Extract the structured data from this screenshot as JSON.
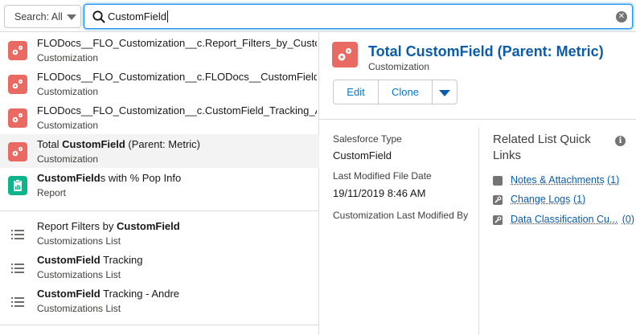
{
  "search": {
    "scope_label": "Search: All",
    "query": "CustomField"
  },
  "results": [
    {
      "title": "FLODocs__FLO_Customization__c.Report_Filters_by_Custom...",
      "subtitle": "Customization",
      "icon": "customization-gears-icon"
    },
    {
      "title": "FLODocs__FLO_Customization__c.FLODocs__CustomField_Tr...",
      "subtitle": "Customization",
      "icon": "customization-gears-icon"
    },
    {
      "title": "FLODocs__FLO_Customization__c.CustomField_Tracking_An...",
      "subtitle": "Customization",
      "icon": "customization-gears-icon"
    },
    {
      "title_pre": "Total ",
      "title_bold": "CustomField",
      "title_post": " (Parent: Metric)",
      "subtitle": "Customization",
      "icon": "customization-gears-icon"
    },
    {
      "title_pre": "",
      "title_bold": "CustomField",
      "title_post": "s with % Pop Info",
      "subtitle": "Report",
      "icon": "report-icon"
    }
  ],
  "lists": [
    {
      "title_pre": "Report Filters by ",
      "title_bold": "CustomField",
      "title_post": "",
      "subtitle": "Customizations List",
      "icon": "list-icon"
    },
    {
      "title_pre": "",
      "title_bold": "CustomField",
      "title_post": " Tracking",
      "subtitle": "Customizations List",
      "icon": "list-icon"
    },
    {
      "title_pre": "",
      "title_bold": "CustomField",
      "title_post": " Tracking - Andre",
      "subtitle": "Customizations List",
      "icon": "list-icon"
    }
  ],
  "detail": {
    "title": "Total CustomField (Parent: Metric)",
    "subtitle": "Customization",
    "buttons": {
      "edit": "Edit",
      "clone": "Clone"
    },
    "fields": [
      {
        "label": "Salesforce Type",
        "value": "CustomField"
      },
      {
        "label": "Last Modified File Date",
        "value": "19/11/2019 8:46 AM"
      },
      {
        "label": "Customization Last Modified By",
        "value": ""
      }
    ],
    "related_title": "Related List Quick Links",
    "related": [
      {
        "label": "Notes & Attachments",
        "count": "(1)",
        "icon": "notes-icon"
      },
      {
        "label": "Change Logs",
        "count": "(1)",
        "icon": "wrench-icon"
      },
      {
        "label": "Data Classification Cu...",
        "count": "(0)",
        "icon": "wrench-icon"
      }
    ]
  },
  "colors": {
    "accent": "#0176d3",
    "link": "#0b5cab",
    "customization_icon": "#e96a63",
    "report_icon": "#0eb58a"
  }
}
